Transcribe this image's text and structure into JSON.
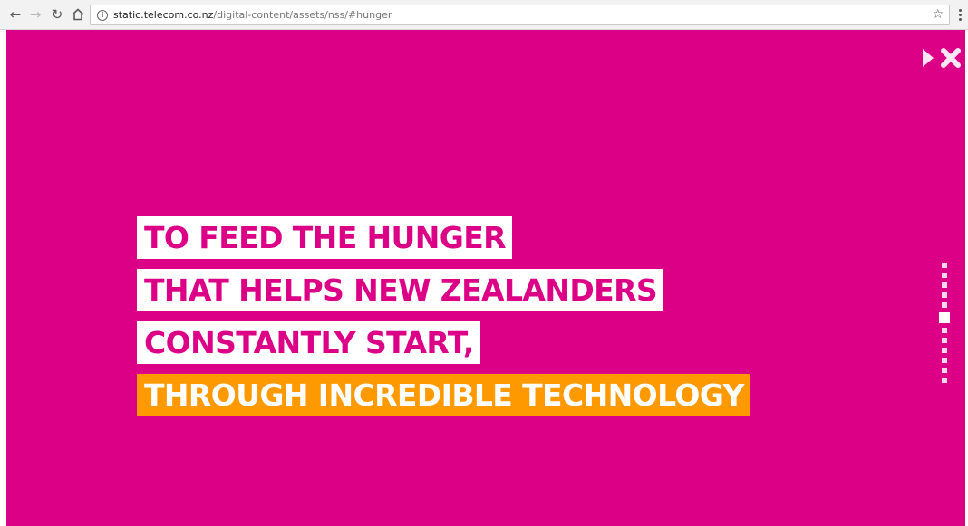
{
  "browser": {
    "url_host": "static.telecom.co.nz",
    "url_path": "/digital-content/assets/nss/#hunger",
    "back_icon": "arrow-left-icon",
    "forward_icon": "arrow-right-icon",
    "reload_icon": "reload-icon",
    "home_icon": "home-icon",
    "bookmark_icon": "star-icon",
    "menu_icon": "kebab-menu-icon"
  },
  "page": {
    "background_color": "#dc0086",
    "accent_color": "#ff9900",
    "headline_lines": [
      "TO FEED THE HUNGER",
      "THAT HELPS NEW ZEALANDERS",
      "CONSTANTLY START,",
      "THROUGH INCREDIBLE TECHNOLOGY"
    ],
    "controls": {
      "play_icon": "play-icon",
      "close_icon": "close-icon"
    },
    "pager": {
      "total": 12,
      "active_index": 5
    }
  }
}
